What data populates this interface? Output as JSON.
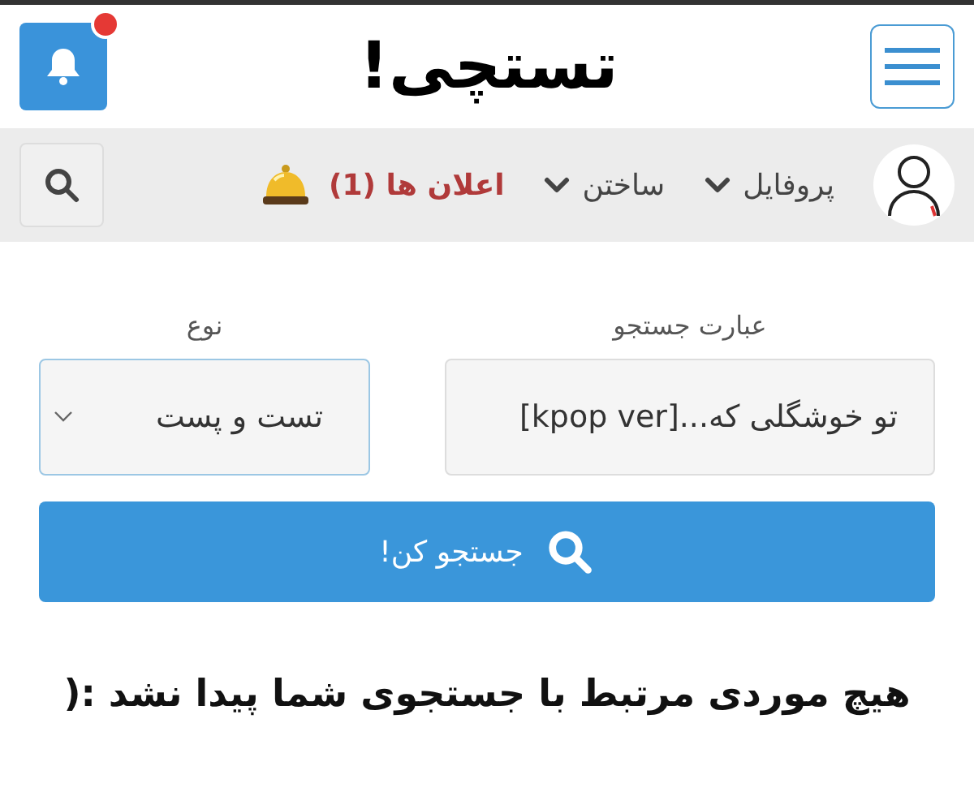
{
  "header": {
    "logo": "تستچی!",
    "notifications": {
      "unread": true
    }
  },
  "nav": {
    "items": [
      {
        "label": "پروفایل",
        "kind": "dropdown"
      },
      {
        "label": "ساختن",
        "kind": "dropdown"
      },
      {
        "label": "اعلان ها (1)",
        "kind": "alert"
      }
    ]
  },
  "form": {
    "query": {
      "label": "عبارت جستجو",
      "value": "تو خوشگلی که...[kpop ver]"
    },
    "type": {
      "label": "نوع",
      "value": "تست و پست"
    },
    "submit": "جستجو کن!"
  },
  "message": "هیچ موردی مرتبط با جستجوی شما پیدا نشد :("
}
